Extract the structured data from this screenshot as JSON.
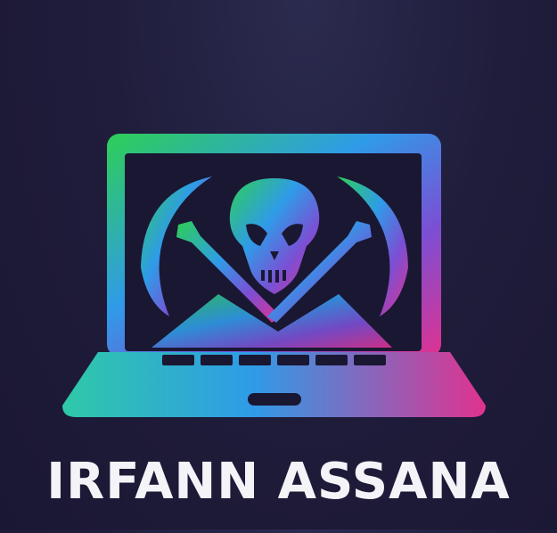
{
  "brand": {
    "name": "IRFANN ASSANA"
  },
  "logo": {
    "icon": "laptop-skull-icon",
    "gradient": [
      "#2ecf55",
      "#2f9be8",
      "#7b4fd4",
      "#e0328f"
    ],
    "screen_color": "#1a1733"
  }
}
